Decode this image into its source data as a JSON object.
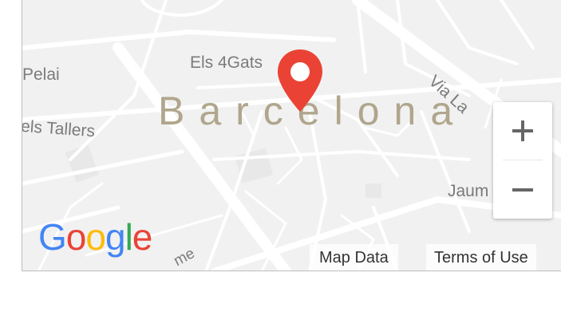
{
  "map": {
    "city_label": "Barcelona",
    "street_labels": {
      "pelai": "Pelai",
      "els_4gats": "Els 4Gats",
      "els_tallers": "els Tallers",
      "via_laietana": "Via La",
      "jaume": "Jaum",
      "bottom_street": "me"
    },
    "colors": {
      "background": "#f1f1f1",
      "road": "#ffffff",
      "city_label": "#b0a68d",
      "marker": "#ea4335",
      "zoom_icon": "#666666"
    }
  },
  "controls": {
    "zoom_in_icon": "plus-icon",
    "zoom_out_icon": "minus-icon"
  },
  "attribution": {
    "logo_letters": [
      "G",
      "o",
      "o",
      "g",
      "l",
      "e"
    ],
    "logo_colors": [
      "#4285f4",
      "#ea4335",
      "#fbbc05",
      "#4285f4",
      "#34a853",
      "#ea4335"
    ],
    "map_data": "Map Data",
    "terms": "Terms of Use"
  }
}
